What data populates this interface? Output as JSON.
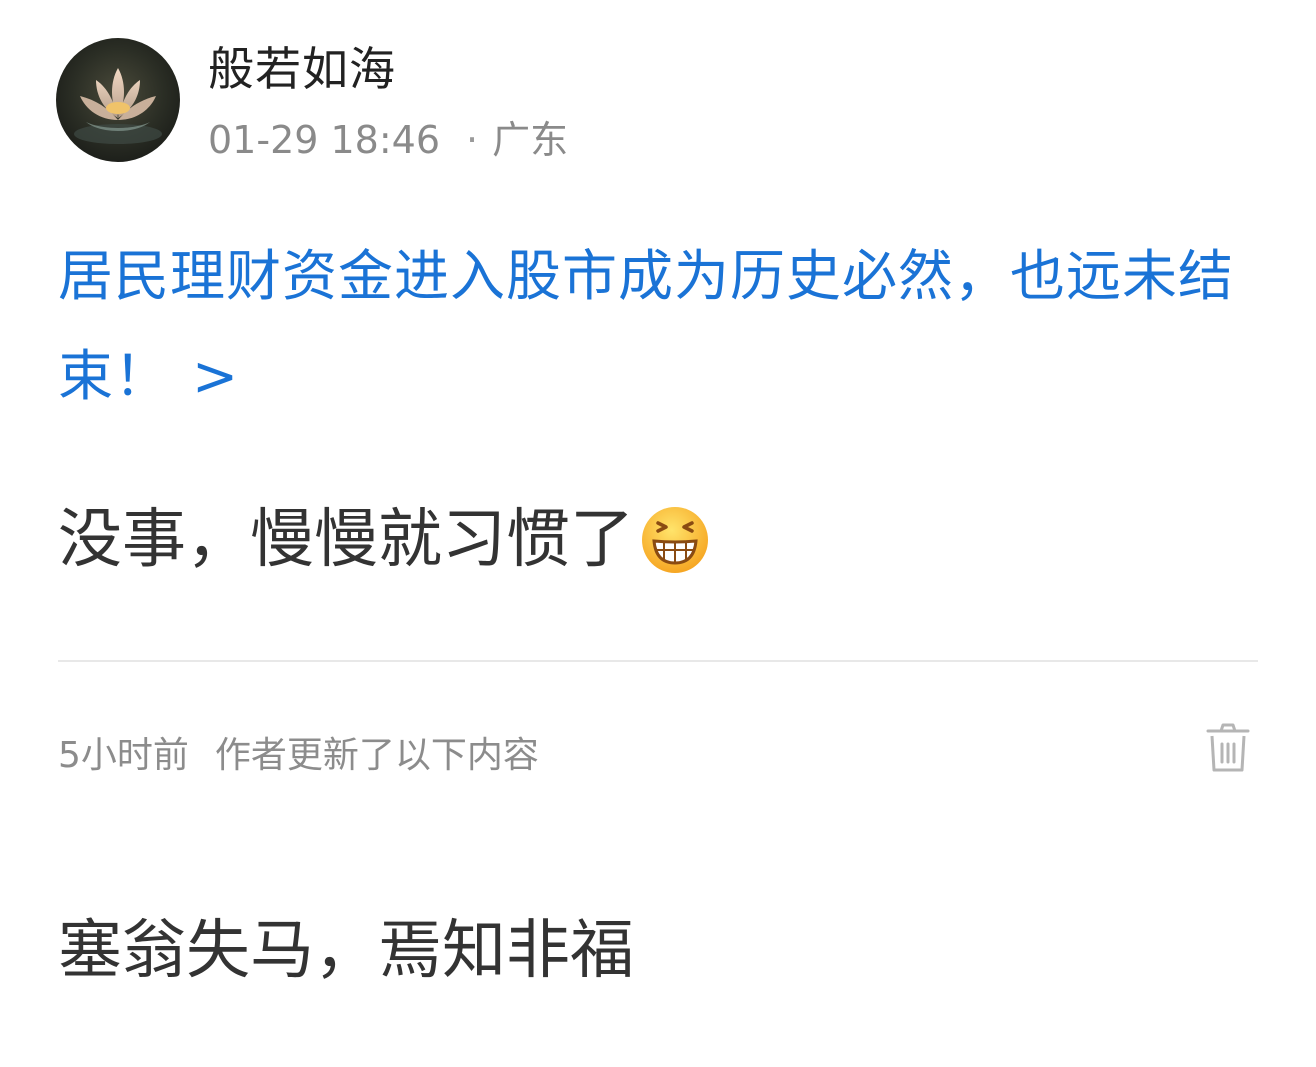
{
  "post": {
    "author": {
      "name": "般若如海",
      "avatar_icon": "lotus-avatar-icon"
    },
    "date": "01-29 18:46",
    "separator": "·",
    "location": "广东",
    "topic_link": {
      "text": "居民理财资金进入股市成为历史必然，也远未结束！",
      "chevron": ">",
      "color": "#1a73d6"
    },
    "body": "没事，慢慢就习惯了",
    "body_emoji": "grinning-face-emoji"
  },
  "update": {
    "time": "5小时前",
    "label": "作者更新了以下内容",
    "delete_icon": "trash-icon",
    "text": "塞翁失马，焉知非福"
  }
}
